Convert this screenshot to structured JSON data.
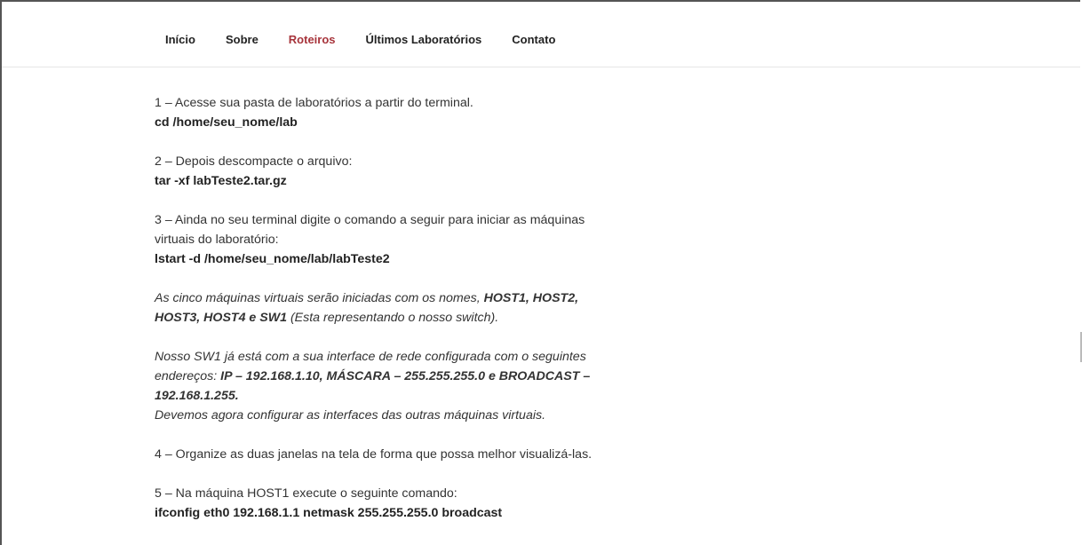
{
  "nav": {
    "items": [
      {
        "label": "Início",
        "active": false
      },
      {
        "label": "Sobre",
        "active": false
      },
      {
        "label": "Roteiros",
        "active": true
      },
      {
        "label": "Últimos Laboratórios",
        "active": false
      },
      {
        "label": "Contato",
        "active": false
      }
    ]
  },
  "colors": {
    "accent": "#a7343b",
    "text": "#333333"
  },
  "content": {
    "step1_text": "1 – Acesse sua pasta de laboratórios a partir do terminal.",
    "step1_cmd": "cd /home/seu_nome/lab",
    "step2_text": "2 – Depois descompacte o arquivo:",
    "step2_cmd": "tar -xf labTeste2.tar.gz",
    "step3_text": "3 – Ainda no seu terminal digite o comando a seguir para iniciar as máquinas virtuais do laboratório:",
    "step3_cmd": "lstart -d /home/seu_nome/lab/labTeste2",
    "vms_intro": "As cinco máquinas virtuais serão iniciadas com os nomes, ",
    "vms_names_a": "HOST1, HOST2, HOST3, HOST4 e SW1",
    "vms_note": " (Esta representando o nosso switch).",
    "sw1_intro": "Nosso SW1 já está com a sua interface de rede configurada com o seguintes endereços: ",
    "sw1_addr": "IP – 192.168.1.10, MÁSCARA – 255.255.255.0 e BROADCAST – 192.168.1.255.",
    "sw1_next": "Devemos agora configurar as interfaces das outras máquinas virtuais.",
    "step4_text": "4 – Organize as duas janelas na tela de forma que possa melhor visualizá-las.",
    "step5_text": "5 – Na máquina HOST1 execute o seguinte comando:",
    "step5_cmd": "ifconfig eth0 192.168.1.1 netmask 255.255.255.0 broadcast"
  }
}
